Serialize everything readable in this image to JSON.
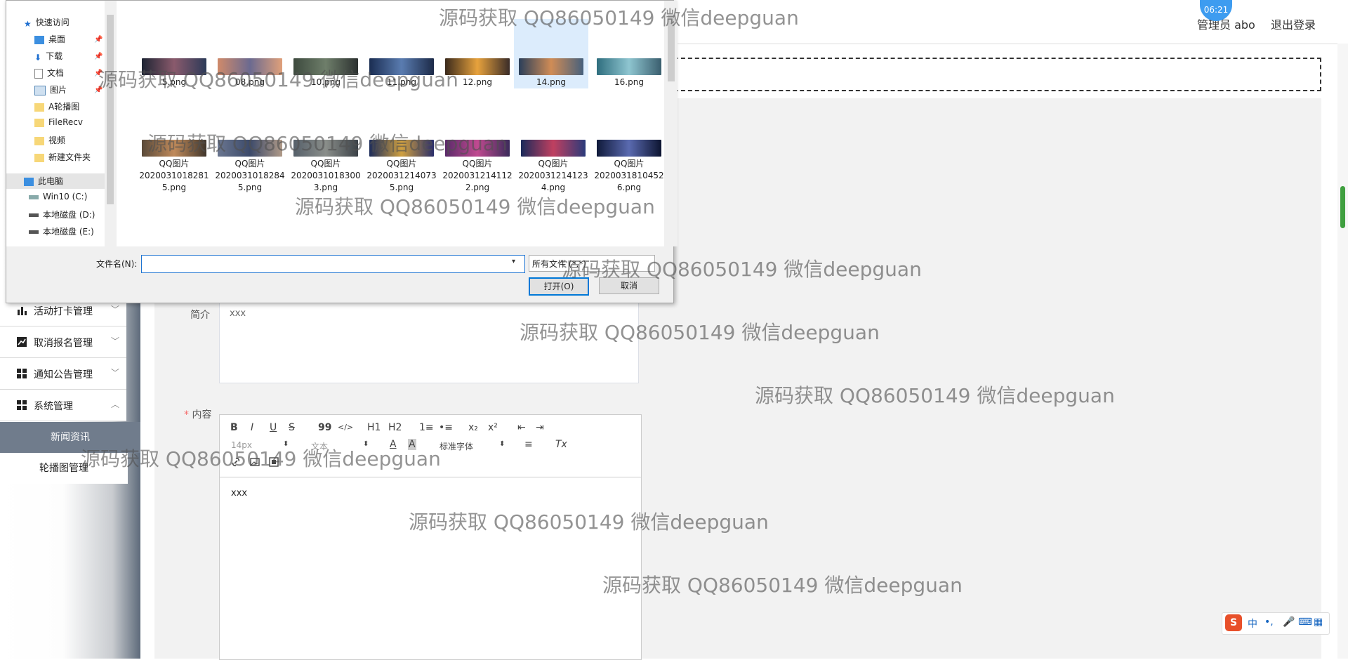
{
  "header": {
    "user": "管理员 abo",
    "logout": "退出登录",
    "clock": "06:21"
  },
  "sidebar": {
    "items": [
      {
        "label": "活动打卡管理",
        "icon": "bar-chart-icon"
      },
      {
        "label": "取消报名管理",
        "icon": "line-chart-icon"
      },
      {
        "label": "通知公告管理",
        "icon": "grid-icon"
      },
      {
        "label": "系统管理",
        "icon": "grid-icon"
      }
    ],
    "sub_items": [
      {
        "label": "新闻资讯",
        "active": true
      },
      {
        "label": "轮播图管理",
        "active": false
      }
    ]
  },
  "form": {
    "intro_label": "简介",
    "intro_value": "xxx",
    "content_label": "内容",
    "content_required": "*",
    "content_value": "xxx",
    "editor": {
      "bold": "B",
      "italic": "I",
      "underline": "U",
      "strike": "S",
      "quote": "99",
      "code": "</>",
      "h1": "H1",
      "h2": "H2",
      "ol": "1≡",
      "ul": "•≡",
      "sub": "x₂",
      "sup": "x²",
      "outdent": "⇤",
      "indent": "⇥",
      "size": "14px",
      "style": "文本",
      "font_color": "A",
      "bg_color": "A",
      "font": "标准字体",
      "align": "≡",
      "clean": "Tx",
      "link": "link",
      "image": "image",
      "video": "video"
    }
  },
  "dialog": {
    "nav": [
      {
        "label": "快速访问",
        "icon": "star-icon",
        "pinned": false
      },
      {
        "label": "桌面",
        "icon": "desktop-icon",
        "pinned": true
      },
      {
        "label": "下载",
        "icon": "download-icon",
        "pinned": true
      },
      {
        "label": "文档",
        "icon": "document-icon",
        "pinned": true
      },
      {
        "label": "图片",
        "icon": "picture-icon",
        "pinned": true
      },
      {
        "label": "A轮播图",
        "icon": "folder-icon",
        "pinned": false
      },
      {
        "label": "FileRecv",
        "icon": "folder-icon",
        "pinned": false
      },
      {
        "label": "视频",
        "icon": "folder-icon",
        "pinned": false
      },
      {
        "label": "新建文件夹",
        "icon": "folder-icon",
        "pinned": false
      },
      {
        "label": "此电脑",
        "icon": "computer-icon",
        "pinned": false
      },
      {
        "label": "Win10 (C:)",
        "icon": "drive-icon",
        "pinned": false
      },
      {
        "label": "本地磁盘 (D:)",
        "icon": "drive-icon",
        "pinned": false
      },
      {
        "label": "本地磁盘 (E:)",
        "icon": "drive-icon",
        "pinned": false
      }
    ],
    "files_row1": [
      "5.png",
      "08.png",
      "10.png",
      "11.png",
      "12.png",
      "14.png",
      "16.png"
    ],
    "files_row2": [
      [
        "QQ图片",
        "2020031018281",
        "5.png"
      ],
      [
        "QQ图片",
        "2020031018284",
        "5.png"
      ],
      [
        "QQ图片",
        "2020031018300",
        "3.png"
      ],
      [
        "QQ图片",
        "2020031214073",
        "5.png"
      ],
      [
        "QQ图片",
        "2020031214112",
        "2.png"
      ],
      [
        "QQ图片",
        "2020031214123",
        "4.png"
      ],
      [
        "QQ图片",
        "2020031810452",
        "6.png"
      ]
    ],
    "filename_label": "文件名(N):",
    "filename_value": "",
    "filetype": "所有文件 (*.*)",
    "open": "打开(O)",
    "cancel": "取消"
  },
  "watermark": "源码获取 QQ86050149 微信deepguan",
  "ime": {
    "logo": "S",
    "lang": "中",
    "punct": "•,",
    "mic": "mic",
    "keyboard": "kbd",
    "grid": "grid"
  }
}
